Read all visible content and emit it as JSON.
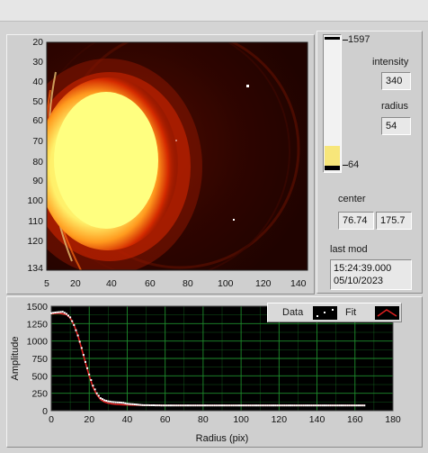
{
  "image_panel": {
    "y_ticks": [
      "20",
      "30",
      "40",
      "50",
      "60",
      "70",
      "80",
      "90",
      "100",
      "110",
      "120",
      "134"
    ],
    "x_ticks": [
      "5",
      "20",
      "40",
      "60",
      "80",
      "100",
      "120",
      "140"
    ]
  },
  "colorbar": {
    "max_label": "1597",
    "min_label": "64",
    "level": 0.18
  },
  "intensity": {
    "label": "intensity",
    "value": "340"
  },
  "radius": {
    "label": "radius",
    "value": "54"
  },
  "center": {
    "label": "center",
    "x": "76.74",
    "y": "175.7"
  },
  "last_mod": {
    "label": "last mod",
    "time": "15:24:39.000",
    "date": "05/10/2023"
  },
  "legend": {
    "data_label": "Data",
    "fit_label": "Fit"
  },
  "colors": {
    "data_marker": "#ffffff",
    "fit_line": "#e02020",
    "grid": "#1e8c2c",
    "plot_bg": "#000000"
  },
  "chart_data": {
    "type": "scatter",
    "xlabel": "Radius (pix)",
    "ylabel": "Amplitude",
    "xlim": [
      0,
      180
    ],
    "ylim": [
      0,
      1500
    ],
    "x_ticks": [
      "0",
      "20",
      "40",
      "60",
      "80",
      "100",
      "120",
      "140",
      "160",
      "180"
    ],
    "y_ticks": [
      "0",
      "250",
      "500",
      "750",
      "1000",
      "1250",
      "1500"
    ],
    "grid": true,
    "legend_position": "top-right",
    "series": [
      {
        "name": "Data",
        "x": [
          0,
          2,
          4,
          6,
          8,
          10,
          12,
          14,
          16,
          18,
          20,
          22,
          24,
          26,
          28,
          30,
          32,
          34,
          36,
          38,
          40,
          44,
          48,
          52,
          56,
          60,
          70,
          80,
          90,
          100,
          110,
          120,
          130,
          140,
          150,
          160,
          165
        ],
        "y": [
          1400,
          1410,
          1415,
          1420,
          1390,
          1340,
          1230,
          1080,
          900,
          700,
          520,
          360,
          250,
          180,
          150,
          135,
          125,
          120,
          118,
          112,
          100,
          90,
          80,
          78,
          76,
          75,
          75,
          75,
          75,
          75,
          75,
          75,
          75,
          75,
          75,
          75,
          75
        ]
      },
      {
        "name": "Fit",
        "x": [
          0,
          4,
          8,
          10,
          12,
          14,
          16,
          18,
          20,
          22,
          24,
          26,
          28,
          30,
          32,
          34,
          36,
          38,
          40,
          44,
          48,
          52,
          56,
          60,
          70,
          80,
          100,
          120,
          140,
          160,
          165
        ],
        "y": [
          1390,
          1400,
          1380,
          1330,
          1230,
          1080,
          890,
          690,
          500,
          340,
          230,
          160,
          125,
          108,
          98,
          92,
          88,
          85,
          83,
          80,
          78,
          77,
          76,
          75,
          75,
          75,
          75,
          75,
          75,
          75,
          75
        ]
      }
    ]
  }
}
